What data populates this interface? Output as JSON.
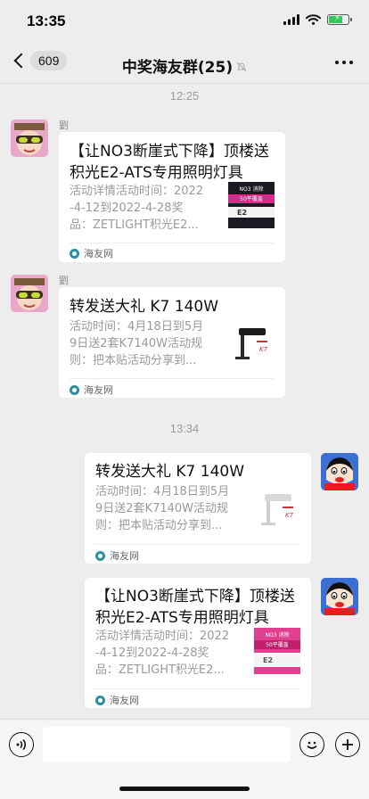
{
  "status_bar": {
    "time": "13:35"
  },
  "header": {
    "back_badge": "609",
    "title": "中奖海友群(25)"
  },
  "timestamps": [
    "12:25",
    "13:34"
  ],
  "messages": [
    {
      "sender": "劉",
      "title": "【让NO3断崖式下降】顶楼送积光E2-ATS专用照明灯具",
      "desc": "活动详情活动时间：2022-4-12到2022-4-28奖品：ZETLIGHT积光E2...",
      "desc_lines": [
        "活动详情活动时间：2022",
        "-4-12到2022-4-28奖",
        "品：ZETLIGHT积光E2..."
      ],
      "source": "海友网",
      "thumb_text": [
        "NO3 消除",
        "50平覆盖",
        "E2"
      ]
    },
    {
      "sender": "劉",
      "title": "转发送大礼 K7 140W",
      "desc_lines": [
        "活动时间：4月18日到5月",
        "9日送2套K7140W活动规",
        "则：把本贴活动分享到..."
      ],
      "source": "海友网"
    },
    {
      "title": "转发送大礼 K7 140W",
      "desc_lines": [
        "活动时间：4月18日到5月",
        "9日送2套K7140W活动规",
        "则：把本贴活动分享到..."
      ],
      "source": "海友网"
    },
    {
      "title": "【让NO3断崖式下降】顶楼送积光E2-ATS专用照明灯具",
      "desc_lines": [
        "活动详情活动时间：2022",
        "-4-12到2022-4-28奖",
        "品：ZETLIGHT积光E2..."
      ],
      "source": "海友网",
      "thumb_text": [
        "NO3 消除",
        "50平覆盖",
        "E2"
      ]
    }
  ],
  "colors": {
    "background": "#ededed",
    "card": "#ffffff",
    "battery": "#34c759",
    "thumb_pink": "#d62b8a"
  }
}
